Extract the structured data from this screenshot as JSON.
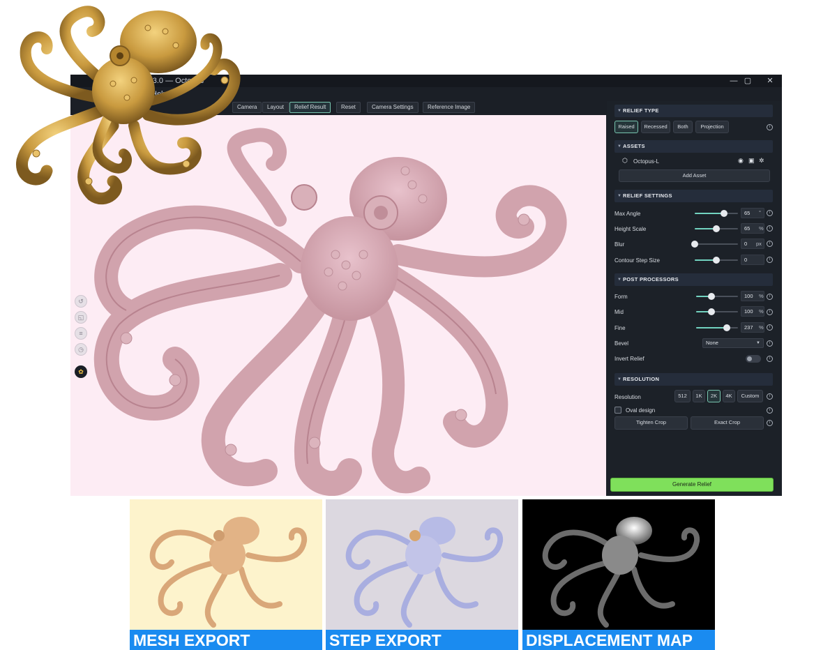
{
  "window": {
    "title": "nal 3.0 — Octopus",
    "menu_help": "Help",
    "minimize": "—",
    "maximize": "▢",
    "close": "✕"
  },
  "toolbar": {
    "camera": "Camera",
    "layout": "Layout",
    "relief_result": "Relief Result",
    "reset": "Reset",
    "camera_settings": "Camera Settings",
    "reference_image": "Reference Image"
  },
  "panel": {
    "relief_type": {
      "header": "RELIEF TYPE",
      "options": [
        "Raised",
        "Recessed",
        "Both",
        "Projection"
      ],
      "selected": "Raised"
    },
    "assets": {
      "header": "ASSETS",
      "item": "Octopus-L",
      "add_button": "Add Asset"
    },
    "relief_settings": {
      "header": "RELIEF SETTINGS",
      "max_angle": {
        "label": "Max Angle",
        "value": "65",
        "unit": "°",
        "level": 0.68
      },
      "height_scale": {
        "label": "Height Scale",
        "value": "65",
        "unit": "%",
        "level": 0.5
      },
      "blur": {
        "label": "Blur",
        "value": "0",
        "unit": "px",
        "level": 0.0
      },
      "contour_step": {
        "label": "Contour Step Size",
        "value": "0",
        "unit": "",
        "level": 0.5
      }
    },
    "post_processors": {
      "header": "POST PROCESSORS",
      "form": {
        "label": "Form",
        "value": "100",
        "unit": "%",
        "level": 0.36
      },
      "mid": {
        "label": "Mid",
        "value": "100",
        "unit": "%",
        "level": 0.36
      },
      "fine": {
        "label": "Fine",
        "value": "237",
        "unit": "%",
        "level": 0.74
      },
      "bevel": {
        "label": "Bevel",
        "value": "None"
      },
      "invert": {
        "label": "Invert Relief"
      }
    },
    "resolution": {
      "header": "RESOLUTION",
      "label": "Resolution",
      "options": [
        "512",
        "1K",
        "2K",
        "4K",
        "Custom"
      ],
      "selected": "2K",
      "oval": "Oval design",
      "tighten": "Tighten Crop",
      "exact": "Exact Crop"
    },
    "generate": "Generate Relief"
  },
  "previews": {
    "mesh": "MESH EXPORT",
    "step": "STEP EXPORT",
    "displacement": "DISPLACEMENT MAP"
  },
  "colors": {
    "accent": "#72d3c0",
    "generate": "#7fe05b",
    "caption_bar": "#1a8bf0",
    "viewport_bg": "#fdecf4",
    "gold": "#c79a3f"
  },
  "icons": [
    "info-icon",
    "eye-icon",
    "lock-icon",
    "gear-icon",
    "cube-icon",
    "triangle-icon"
  ]
}
